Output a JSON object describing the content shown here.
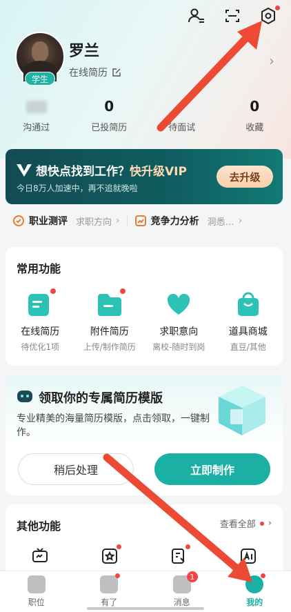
{
  "header": {
    "icons": [
      "person-switch-icon",
      "scan-icon",
      "settings-icon"
    ]
  },
  "profile": {
    "name": "罗兰",
    "badge": "学生",
    "resume_link": "在线简历"
  },
  "stats": [
    {
      "value": "",
      "label": "沟通过"
    },
    {
      "value": "0",
      "label": "已投简历"
    },
    {
      "value": "",
      "label": "待面试"
    },
    {
      "value": "0",
      "label": "收藏"
    }
  ],
  "vip": {
    "title_prefix": "想快点找到工作？",
    "title_highlight": "快升级VIP",
    "subtitle": "今日8万人加速中，再不追就晚啦",
    "button": "去升级"
  },
  "assess": {
    "item1": "职业测评",
    "item1_sub": "求职方向",
    "item2": "竞争力分析",
    "item2_sub": "洞悉…"
  },
  "common": {
    "title": "常用功能",
    "items": [
      {
        "label": "在线简历",
        "sub": "待优化1项",
        "icon": "resume-icon"
      },
      {
        "label": "附件简历",
        "sub": "上传/制作简历",
        "icon": "folder-icon"
      },
      {
        "label": "求职意向",
        "sub": "离校-随时到岗",
        "icon": "heart-icon"
      },
      {
        "label": "道具商城",
        "sub": "直豆/其他",
        "icon": "shopping-bag-icon"
      }
    ]
  },
  "template": {
    "title": "领取你的专属简历模版",
    "desc": "专业精美的海量简历模版，点击领取，一键制作。",
    "later": "稍后处理",
    "make": "立即制作"
  },
  "other": {
    "title": "其他功能",
    "view_all": "查看全部"
  },
  "tabbar": {
    "items": [
      {
        "label": "职位"
      },
      {
        "label": "有了"
      },
      {
        "label": "消息",
        "badge": "1"
      },
      {
        "label": "我的"
      }
    ]
  },
  "colors": {
    "accent": "#1ab0a3",
    "annotation_arrow": "#ec4a35"
  }
}
